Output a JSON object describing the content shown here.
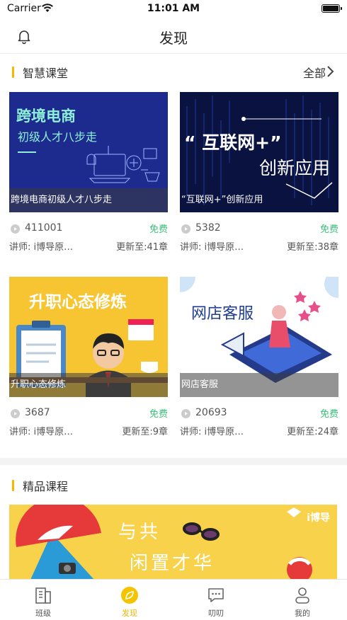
{
  "status_bar": {
    "carrier": "Carrier",
    "time": "11:01 AM"
  },
  "nav": {
    "title": "发现",
    "left_icon": "bell-icon"
  },
  "smart_class": {
    "title": "智慧课堂",
    "more_label": "全部",
    "courses": [
      {
        "thumb_title": "跨境电商",
        "thumb_subtitle": "初级人才八步走",
        "caption": "跨境电商初级人才八步走",
        "plays": "411001",
        "price": "免费",
        "teacher": "讲师: i博导原…",
        "chapters": "更新至:41章"
      },
      {
        "thumb_title": "“ 互联网+”",
        "thumb_subtitle": "创新应用",
        "caption": "“互联网+”创新应用",
        "plays": "5382",
        "price": "免费",
        "teacher": "讲师: i博导原…",
        "chapters": "更新至:38章"
      },
      {
        "thumb_title": "升职心态修炼",
        "caption": "升职心态修炼",
        "plays": "3687",
        "price": "免费",
        "teacher": "讲师: i博导原…",
        "chapters": "更新至:9章"
      },
      {
        "thumb_title": "网店客服",
        "caption": "网店客服",
        "plays": "20693",
        "price": "免费",
        "teacher": "讲师: i博导原…",
        "chapters": "更新至:24章"
      }
    ]
  },
  "premium": {
    "title": "精品课程",
    "banner": {
      "line1": "与共",
      "line2": "闲置才华",
      "logo": "i博导"
    }
  },
  "tab_bar": {
    "tabs": [
      {
        "label": "班级",
        "icon": "building-icon"
      },
      {
        "label": "发现",
        "icon": "leaf-icon",
        "active": true
      },
      {
        "label": "叨叨",
        "icon": "chat-icon"
      },
      {
        "label": "我的",
        "icon": "user-icon"
      }
    ]
  },
  "colors": {
    "accent": "#f5b700",
    "free_green": "#3cbf7a",
    "banner_yellow": "#f8d24a"
  }
}
